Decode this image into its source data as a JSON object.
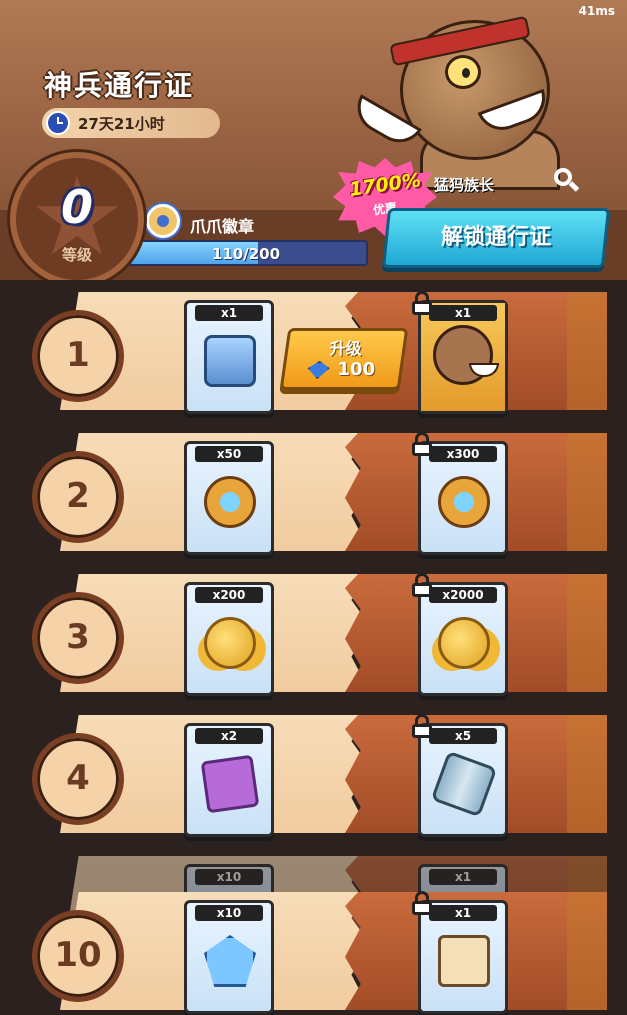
{
  "latency": "41ms",
  "header": {
    "title": "神兵通行证",
    "timer": "27天21小时",
    "hero_name": "猛犸族长",
    "discount": {
      "percent": "1700%",
      "label": "优惠"
    },
    "level": {
      "value": "0",
      "label": "等级"
    },
    "badge": {
      "name": "爪爪徽章",
      "progress_text": "110/200",
      "progress": 0.55
    },
    "unlock_button": "解锁通行证"
  },
  "upgrade": {
    "label": "升级",
    "cost": "100"
  },
  "rows": [
    {
      "level": "1",
      "free": {
        "qty": "x1",
        "icon": "chest-icon"
      },
      "premium": {
        "qty": "x1",
        "icon": "hero-portrait-icon",
        "locked": true
      }
    },
    {
      "level": "2",
      "free": {
        "qty": "x50",
        "icon": "paw-badge-icon"
      },
      "premium": {
        "qty": "x300",
        "icon": "paw-badge-icon",
        "locked": true
      }
    },
    {
      "level": "3",
      "free": {
        "qty": "x200",
        "icon": "gold-coins-icon"
      },
      "premium": {
        "qty": "x2000",
        "icon": "gold-coins-icon",
        "locked": true
      }
    },
    {
      "level": "4",
      "free": {
        "qty": "x2",
        "icon": "mystery-cards-icon"
      },
      "premium": {
        "qty": "x5",
        "icon": "canister-icon",
        "locked": true
      }
    },
    {
      "level": "10",
      "free": {
        "qty": "x10",
        "icon": "diamonds-icon"
      },
      "premium": {
        "qty": "x1",
        "icon": "scroll-icon",
        "locked": true
      }
    }
  ],
  "ghost_row": {
    "free_qty": "x10",
    "premium_qty": "x1"
  }
}
